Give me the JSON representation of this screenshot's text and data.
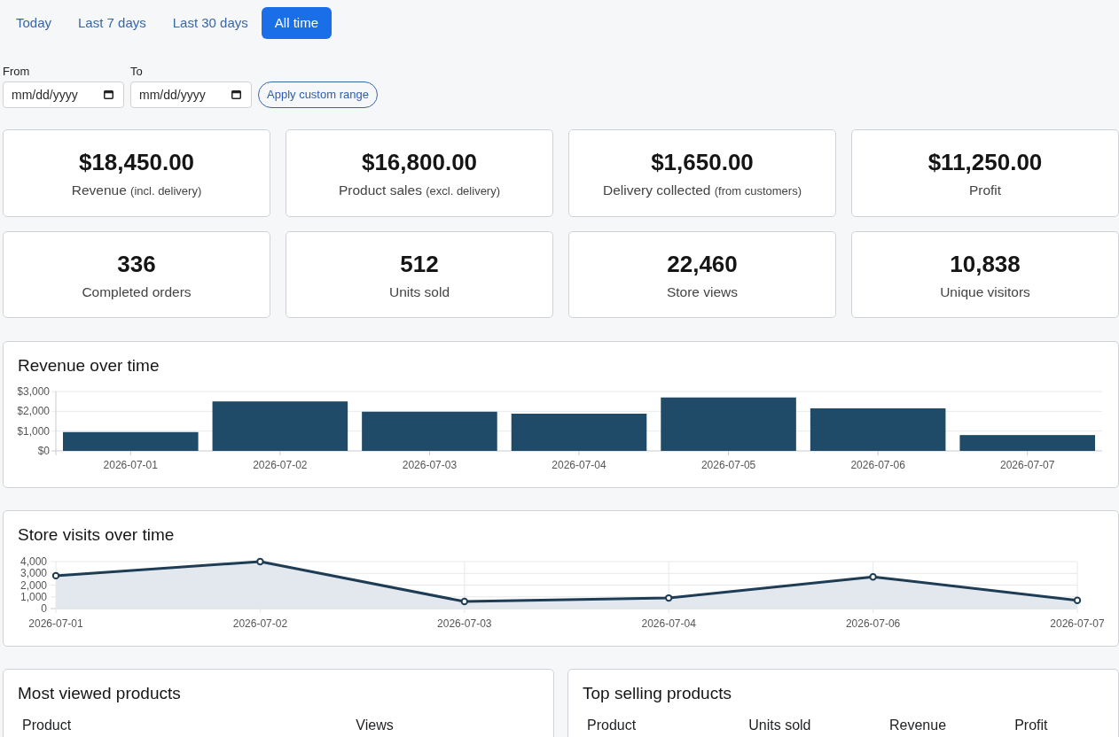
{
  "range_tabs": [
    {
      "label": "Today",
      "selected": false
    },
    {
      "label": "Last 7 days",
      "selected": false
    },
    {
      "label": "Last 30 days",
      "selected": false
    },
    {
      "label": "All time",
      "selected": true
    }
  ],
  "custom_range": {
    "from": {
      "label": "From",
      "placeholder": "mm/dd/yyyy"
    },
    "to": {
      "label": "To",
      "placeholder": "mm/dd/yyyy"
    },
    "apply_button": "Apply custom range"
  },
  "stats": [
    {
      "value": "$18,450.00",
      "label": "Revenue",
      "note": "(incl. delivery)"
    },
    {
      "value": "$16,800.00",
      "label": "Product sales",
      "note": "(excl. delivery)"
    },
    {
      "value": "$1,650.00",
      "label": "Delivery collected",
      "note": "(from customers)"
    },
    {
      "value": "$11,250.00",
      "label": "Profit"
    },
    {
      "value": "336",
      "label": "Completed orders"
    },
    {
      "value": "512",
      "label": "Units sold"
    },
    {
      "value": "22,460",
      "label": "Store views"
    },
    {
      "value": "10,838",
      "label": "Unique visitors"
    }
  ],
  "revenue_chart": {
    "chart_data": {
      "type": "bar",
      "title": "Revenue over time",
      "categories": [
        "2026-07-01",
        "2026-07-02",
        "2026-07-03",
        "2026-07-04",
        "2026-07-05",
        "2026-07-06",
        "2026-07-07"
      ],
      "values": [
        950,
        2500,
        1980,
        1880,
        2700,
        2150,
        800
      ],
      "ylim": [
        0,
        3000
      ],
      "yticks": [
        {
          "value": 0,
          "label": "$0"
        },
        {
          "value": 1000,
          "label": "$1,000"
        },
        {
          "value": 2000,
          "label": "$2,000"
        },
        {
          "value": 3000,
          "label": "$3,000"
        }
      ],
      "grid": true
    }
  },
  "visits_chart": {
    "chart_data": {
      "type": "area",
      "title": "Store visits over time",
      "categories": [
        "2026-07-01",
        "2026-07-02",
        "2026-07-03",
        "2026-07-04",
        "2026-07-06",
        "2026-07-07"
      ],
      "values": [
        2800,
        4000,
        600,
        900,
        2700,
        700
      ],
      "ylim": [
        0,
        4000
      ],
      "yticks": [
        {
          "value": 0,
          "label": "0"
        },
        {
          "value": 1000,
          "label": "1,000"
        },
        {
          "value": 2000,
          "label": "2,000"
        },
        {
          "value": 3000,
          "label": "3,000"
        },
        {
          "value": 4000,
          "label": "4,000"
        }
      ],
      "grid": true
    }
  },
  "most_viewed": {
    "title": "Most viewed products",
    "columns": [
      "Product",
      "Views"
    ]
  },
  "top_selling": {
    "title": "Top selling products",
    "columns": [
      "Product",
      "Units sold",
      "Revenue",
      "Profit"
    ]
  }
}
